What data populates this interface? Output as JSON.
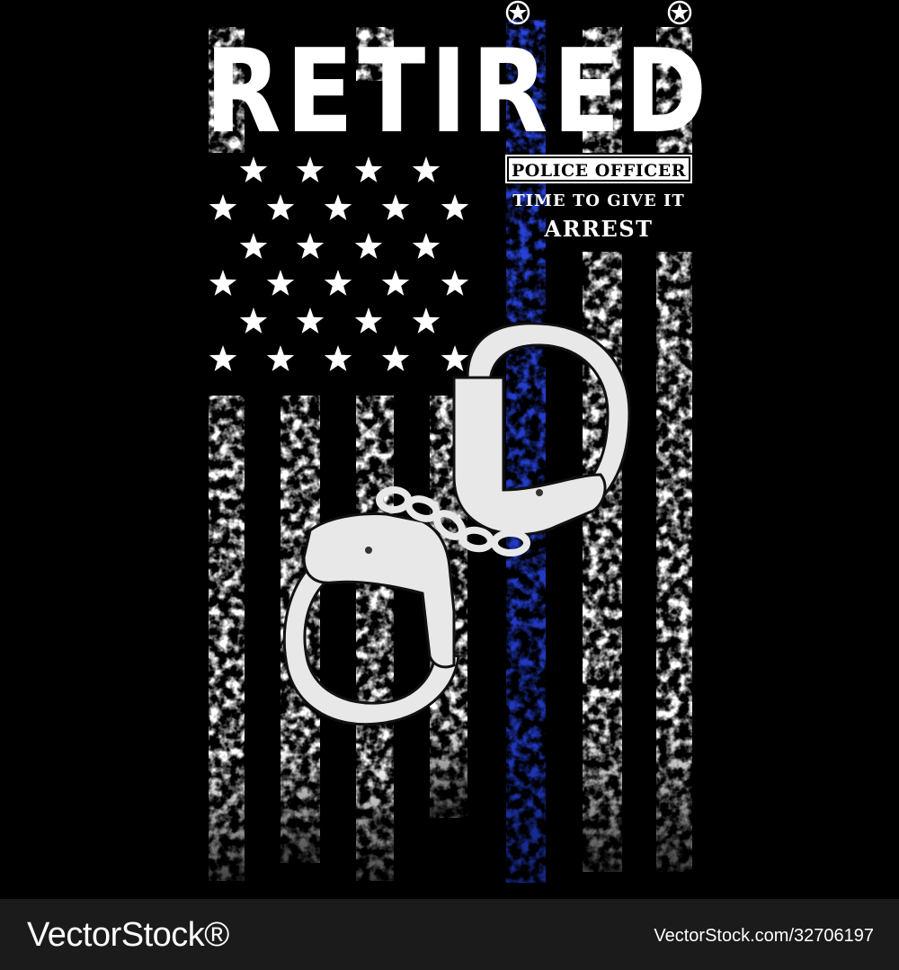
{
  "artwork": {
    "headline": "RETIRED",
    "badge": "POLICE OFFICER",
    "tagline_line1": "TIME TO GIVE IT",
    "tagline_line2": "ARREST",
    "icons": [
      "star-icon",
      "handcuffs-icon",
      "circle-star-icon"
    ],
    "colors": {
      "background": "#000000",
      "stripe_white": "#ffffff",
      "thin_blue_line": "#1f3fd0",
      "handcuffs": "#e6e6e6"
    }
  },
  "footer": {
    "watermark_left": "VectorStock®",
    "watermark_right": "VectorStock.com/32706197",
    "background": "#1b1b1b"
  }
}
